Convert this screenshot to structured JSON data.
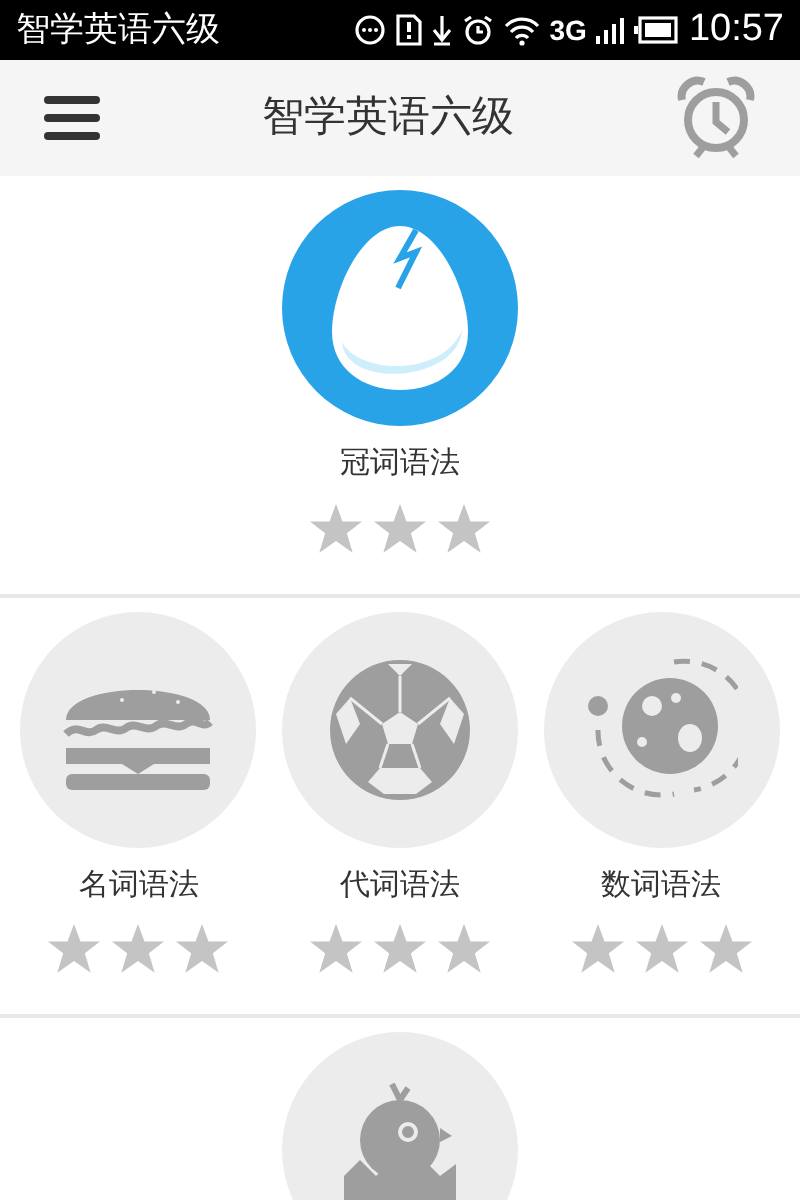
{
  "status_bar": {
    "app_name": "智学英语六级",
    "network": "3G",
    "time": "10:57"
  },
  "header": {
    "title": "智学英语六级"
  },
  "sections": [
    {
      "lessons": [
        {
          "kind": "egg",
          "title": "冠词语法",
          "locked": false,
          "stars": 0
        }
      ]
    },
    {
      "lessons": [
        {
          "kind": "burger",
          "title": "名词语法",
          "locked": true,
          "stars": 0
        },
        {
          "kind": "ball",
          "title": "代词语法",
          "locked": true,
          "stars": 0
        },
        {
          "kind": "planet",
          "title": "数词语法",
          "locked": true,
          "stars": 0
        }
      ]
    },
    {
      "lessons": [
        {
          "kind": "chick",
          "locked": true
        }
      ]
    }
  ]
}
